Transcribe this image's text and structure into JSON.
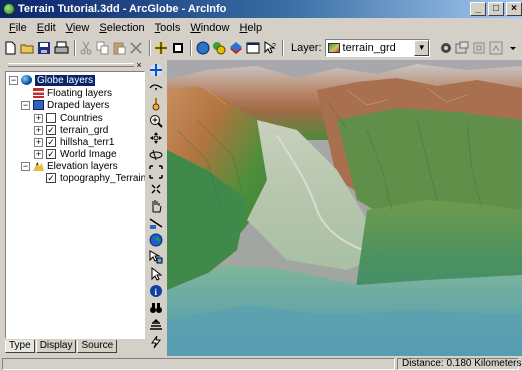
{
  "window": {
    "title": "Terrain Tutorial.3dd - ArcGlobe - ArcInfo",
    "buttons": {
      "minimize": "_",
      "maximize": "□",
      "close": "×"
    }
  },
  "menu": [
    {
      "label": "File",
      "u": "F",
      "rest": "ile"
    },
    {
      "label": "Edit",
      "u": "E",
      "rest": "dit"
    },
    {
      "label": "View",
      "u": "V",
      "rest": "iew"
    },
    {
      "label": "Selection",
      "u": "S",
      "rest": "election"
    },
    {
      "label": "Tools",
      "u": "T",
      "rest": "ools"
    },
    {
      "label": "Window",
      "u": "W",
      "rest": "indow"
    },
    {
      "label": "Help",
      "u": "H",
      "rest": "elp"
    }
  ],
  "toolbar": {
    "layer_label": "Layer:",
    "layer_value": "terrain_grd",
    "icons": [
      "new-document-icon",
      "open-folder-icon",
      "save-icon",
      "print-icon",
      "cut-icon",
      "copy-icon",
      "paste-icon",
      "delete-icon",
      "add-data-icon",
      "full-screen-icon",
      "globe-properties-icon",
      "animation-icon",
      "layer-3d-icon",
      "window-icon",
      "whats-this-icon"
    ]
  },
  "toc": {
    "close_glyph": "×",
    "items": [
      {
        "label": "Globe layers",
        "expander": "−",
        "icon": "globe",
        "selected": true
      },
      {
        "label": "Floating layers",
        "icon": "float"
      },
      {
        "label": "Draped layers",
        "expander": "−",
        "icon": "drape"
      },
      {
        "label": "Countries",
        "expander": "+",
        "checked": false
      },
      {
        "label": "terrain_grd",
        "expander": "+",
        "checked": true
      },
      {
        "label": "hillsha_terr1",
        "expander": "+",
        "checked": true
      },
      {
        "label": "World Image",
        "expander": "+",
        "checked": true
      },
      {
        "label": "Elevation layers",
        "expander": "−",
        "icon": "elev"
      },
      {
        "label": "topography_Terrain",
        "checked": true
      }
    ],
    "tabs": [
      "Type",
      "Display",
      "Source"
    ],
    "active_tab": "Type",
    "check_glyph": "✓"
  },
  "tools": [
    "navigate-icon",
    "fly-icon",
    "target-icon",
    "zoom-in-out-icon",
    "pan-icon",
    "orbit-icon",
    "full-extent-icon",
    "zoom-to-layer-icon",
    "hand-icon",
    "measure-icon",
    "globe-icon",
    "identify-tool-icon",
    "select-icon",
    "info-icon",
    "find-icon",
    "layer-stack-icon",
    "lightning-icon",
    "tools-icon",
    "bookmark-icon"
  ],
  "status": {
    "distance": "Distance: 0.180 Kilometers"
  },
  "colors": {
    "title_bar": "#0a246a",
    "selection": "#0a246a",
    "chrome": "#d4d0c8"
  }
}
